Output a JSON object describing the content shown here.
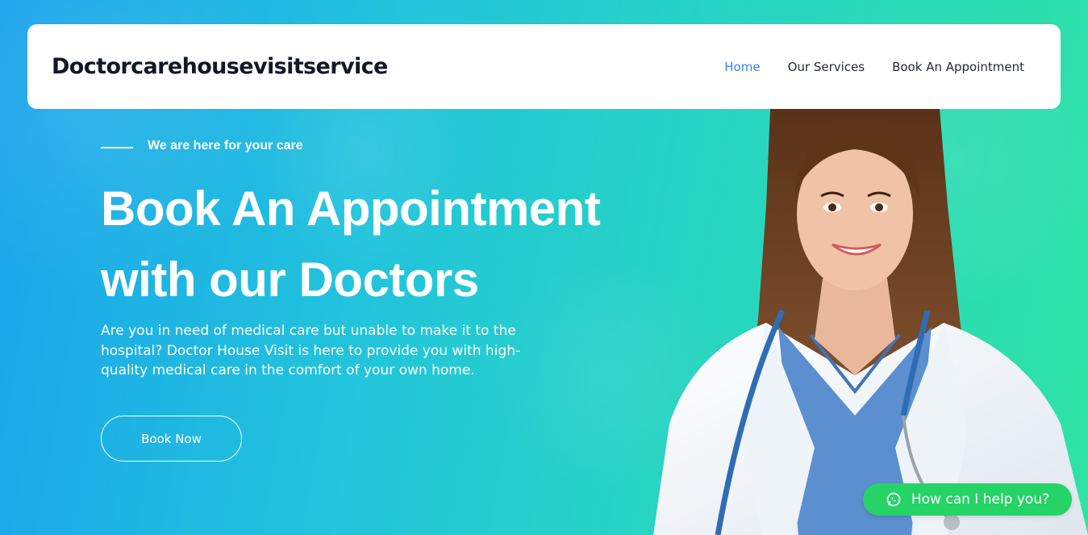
{
  "brand": "Doctorcarehousevisitservice",
  "nav": {
    "home": "Home",
    "services": "Our Services",
    "appointment": "Book An Appointment"
  },
  "hero": {
    "eyebrow": "We are here for your care",
    "title_line1": "Book An Appointment",
    "title_line2": "with our Doctors",
    "description": "Are you in need of medical care but unable to make it to the hospital? Doctor House Visit is here to provide you with high-quality medical care in the comfort of your own home.",
    "cta": "Book Now"
  },
  "chat": {
    "label": "How can I help you?",
    "icon": "whatsapp-icon"
  },
  "colors": {
    "nav_active": "#3b82f6",
    "chat_green": "#25d366",
    "gradient_start": "#1aa3ec",
    "gradient_end": "#2fe3a4"
  }
}
